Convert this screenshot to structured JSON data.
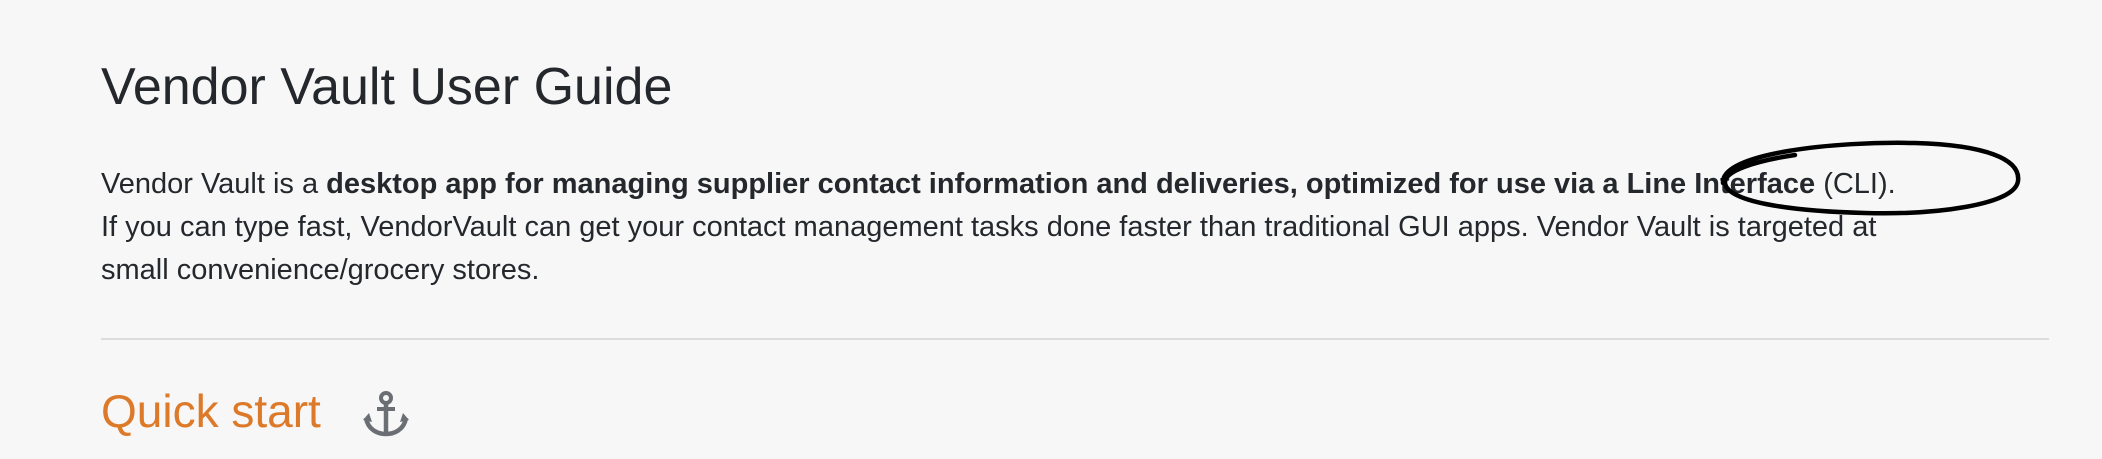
{
  "page": {
    "title": "Vendor Vault User Guide"
  },
  "intro": {
    "line1_prefix": "Vendor Vault is a ",
    "line1_bold": "desktop app for managing supplier contact information and deliveries, optimized for use via a Line Interface",
    "line1_suffix": " (CLI).",
    "line2": "If you can type fast, VendorVault can get your contact management tasks done faster than traditional GUI apps. Vendor Vault is targeted at",
    "line3": "small convenience/grocery stores."
  },
  "section": {
    "heading": "Quick start",
    "icon": "anchor-icon",
    "color": "#dd7a2a"
  },
  "annotation": {
    "shape": "hand-drawn-ellipse",
    "color": "#000000"
  }
}
